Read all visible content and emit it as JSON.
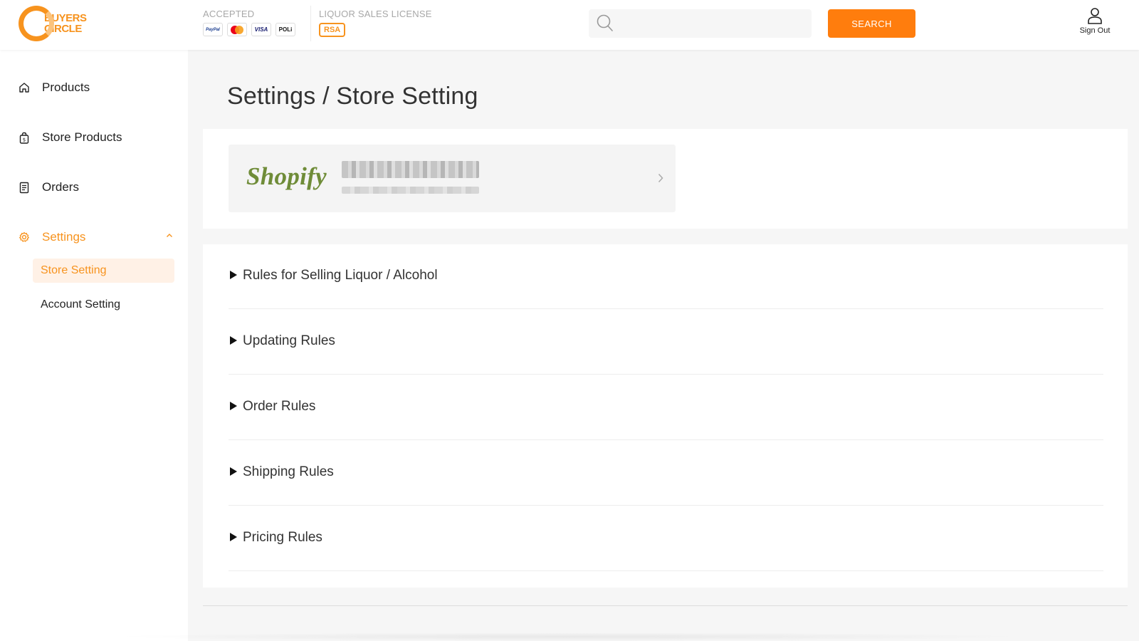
{
  "header": {
    "logo": {
      "line1": "BUYERS",
      "line2": "CIRCLE"
    },
    "accepted_label": "ACCEPTED",
    "payment_methods": [
      "PayPal",
      "Mastercard",
      "VISA",
      "POLi"
    ],
    "license_label": "LIQUOR SALES LICENSE",
    "license_badge": "RSA",
    "search_placeholder": "",
    "search_button": "SEARCH",
    "sign_out": "Sign Out",
    "accent_color": "#ff7d0d"
  },
  "sidebar": {
    "items": [
      {
        "label": "Products",
        "icon": "home-icon"
      },
      {
        "label": "Store Products",
        "icon": "shopping-bag-icon"
      },
      {
        "label": "Orders",
        "icon": "receipt-icon"
      },
      {
        "label": "Settings",
        "icon": "gear-icon",
        "expanded": true
      }
    ],
    "sub_items": [
      {
        "label": "Store Setting",
        "selected": true
      },
      {
        "label": "Account Setting",
        "selected": false
      }
    ]
  },
  "main": {
    "title": "Settings / Store Setting",
    "shop": {
      "platform": "Shopify"
    },
    "rules": [
      "Rules for Selling Liquor / Alcohol",
      "Updating Rules",
      "Order Rules",
      "Shipping Rules",
      "Pricing Rules"
    ]
  }
}
